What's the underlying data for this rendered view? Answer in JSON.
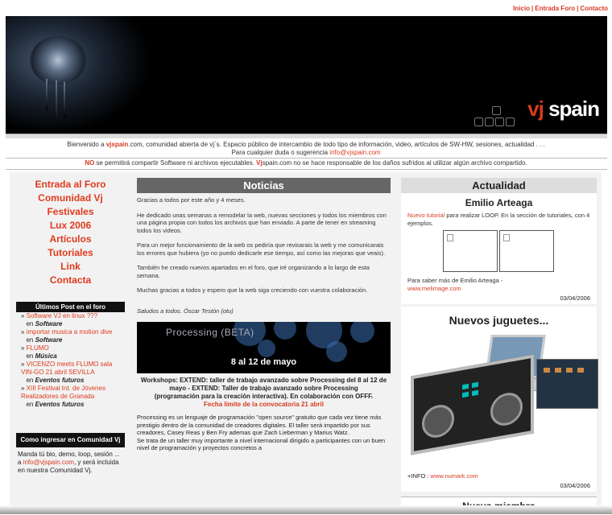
{
  "top_nav": [
    "Inicio",
    "Entrada Foro",
    "Contacto"
  ],
  "banner": {
    "logo_a": "vj",
    "logo_b": "spain"
  },
  "welcome": {
    "line1_pre": "Bienvenido a ",
    "line1_site": "vjspain",
    "line1_post": ".com, comunidad abierta de vj´s. Espacio público de intercambio de todo tipo de información, video, artículos de SW-HW, sesiones, actualidad . . .",
    "line2_pre": "Para cualquier duda o sugerencia ",
    "line2_email": "info@vjspain.com"
  },
  "notice": {
    "no": "NO",
    "text1": " se permitirá compartir Software ni archivos ejecutables. ",
    "vj": "Vj",
    "text2": "spain.com no se hace responsable de los daños sufridos al utilizar algún archivo compartido."
  },
  "menu": [
    "Entrada al Foro",
    "Comunidad Vj",
    "Festivales",
    "Lux 2006",
    "Artículos",
    "Tutoriales",
    "Link",
    "Contacta"
  ],
  "posts": {
    "header": "Últimos Post en el foro",
    "items": [
      {
        "title": "Software VJ en linux ???",
        "in": "en",
        "cat": "Software"
      },
      {
        "title": "importar musica a motion dive",
        "in": "en",
        "cat": "Software"
      },
      {
        "title": "FLUMO",
        "in": "en",
        "cat": "Música"
      },
      {
        "title": "VICENZO meets FLUMO sala VIN-GO 21 abril SEVILLA",
        "in": "en",
        "cat": "Eventos futuros"
      },
      {
        "title": "XIII Festival Int. de Jóvenes Realizadores de Granada",
        "in": "en",
        "cat": "Eventos futuros"
      }
    ]
  },
  "howto": {
    "header": "Como ingresar en Comunidad Vj",
    "text_pre": "Manda tú bio, demo, loop, sesión ... a ",
    "email": "info@vjspain.com",
    "text_post": ", y será incluida en nuestra Comunidad Vj."
  },
  "noticias": {
    "header": "Noticias",
    "paragraphs": [
      "Gracias a todos por este año y 4 meses.",
      "He dedicado unas semanas a remodelar la web, nuevas secciones y todos los miembros con una página propia con todos los archivos que han enviado. A parte de tener en streaming todos los videos.",
      "Para un mejor funcionamiento de la web os pediría que revisarais la web y me comunicarais los errores que hubiera (yo no puedo dedicarle ese tiempo, así como las mejoras que veais).",
      "También he creado nuevos apartados en el foro, que iré organizando a lo largo de esta semana.",
      "Muchas gracias a todos y espero que la web siga creciendo con vuestra colaboración."
    ],
    "signature": "Saludos a todos. Óscar Testón (otu)",
    "promo_title": "Processing (BETA)",
    "promo_date": "8 al 12 de mayo",
    "workshops_line1": "Workshops: EXTEND: taller de trabajo avanzado sobre Processing del 8 al 12 de mayo - EXTEND: Taller de trabajo avanzado sobre Processing",
    "workshops_line2": "(programación para la creación interactiva). En colaboración con OFFF.",
    "workshops_deadline": "Fecha limite de la convocatoria 21 abril",
    "body2_p1": "Processing es un lenguaje de programación \"open source\" gratuito que cada vez tiene más prestigio dentro de la comunidad de creadores digitales. El taller será impartido por sus creadores, Casey Reas y Ben Fry ademas que Zach Lieberman y Marius Watz.",
    "body2_p2": "Se trata de un taller muy importante a nivel internacional dirigido a participantes con un buen nivel de programación y proyectos concretos a"
  },
  "actualidad": {
    "header": "Actualidad",
    "title": "Emilio Arteaga",
    "link": "Nuevo tutorial",
    "text": " para realizar LOOP. En la sección de tutoriales, con 4 ejemplos.",
    "more": "Para saber más de Emilio Arteaga - ",
    "more_link": "www.melimage.com",
    "date": "03/04/2006"
  },
  "juguetes": {
    "title": "Nuevos juguetes...",
    "info_label": "+INFO : ",
    "info_link": "www.numark.com",
    "date": "03/04/2006"
  },
  "nuevo_miembro": {
    "title": "Nuevo miembro"
  },
  "colors": {
    "accent": "#d63b1f",
    "header_gray": "#666666"
  }
}
